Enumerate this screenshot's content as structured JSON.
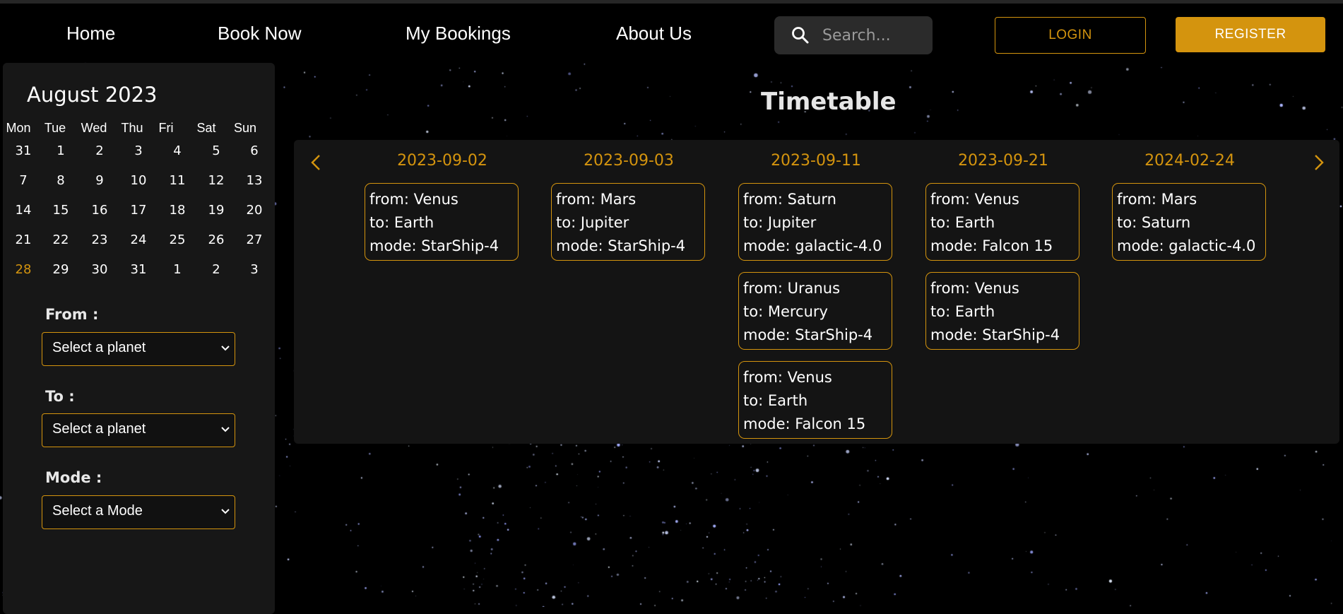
{
  "nav": {
    "links": [
      "Home",
      "Book Now",
      "My Bookings",
      "About Us"
    ],
    "search_placeholder": "Search...",
    "login_label": "LOGIN",
    "register_label": "REGISTER"
  },
  "calendar": {
    "month_title": "August 2023",
    "weekdays": [
      "Mon",
      "Tue",
      "Wed",
      "Thu",
      "Fri",
      "Sat",
      "Sun"
    ],
    "weeks": [
      [
        "31",
        "1",
        "2",
        "3",
        "4",
        "5",
        "6"
      ],
      [
        "7",
        "8",
        "9",
        "10",
        "11",
        "12",
        "13"
      ],
      [
        "14",
        "15",
        "16",
        "17",
        "18",
        "19",
        "20"
      ],
      [
        "21",
        "22",
        "23",
        "24",
        "25",
        "26",
        "27"
      ],
      [
        "28",
        "29",
        "30",
        "31",
        "1",
        "2",
        "3"
      ]
    ],
    "highlighted_day": "28"
  },
  "filters": {
    "from_label": "From :",
    "from_value": "Select a planet",
    "to_label": "To :",
    "to_value": "Select a planet",
    "mode_label": "Mode :",
    "mode_value": "Select a Mode"
  },
  "timetable": {
    "title": "Timetable",
    "columns": [
      {
        "date": "2023-09-02",
        "trips": [
          {
            "from": "from: Venus",
            "to": "to: Earth",
            "mode": "mode: StarShip-4"
          }
        ]
      },
      {
        "date": "2023-09-03",
        "trips": [
          {
            "from": "from: Mars",
            "to": "to: Jupiter",
            "mode": "mode: StarShip-4"
          }
        ]
      },
      {
        "date": "2023-09-11",
        "trips": [
          {
            "from": "from: Saturn",
            "to": "to: Jupiter",
            "mode": "mode: galactic-4.0"
          },
          {
            "from": "from: Uranus",
            "to": "to: Mercury",
            "mode": "mode: StarShip-4"
          },
          {
            "from": "from: Venus",
            "to": "to: Earth",
            "mode": "mode: Falcon 15"
          }
        ]
      },
      {
        "date": "2023-09-21",
        "trips": [
          {
            "from": "from: Venus",
            "to": "to: Earth",
            "mode": "mode: Falcon 15"
          },
          {
            "from": "from: Venus",
            "to": "to: Earth",
            "mode": "mode: StarShip-4"
          }
        ]
      },
      {
        "date": "2024-02-24",
        "trips": [
          {
            "from": "from: Mars",
            "to": "to: Saturn",
            "mode": "mode: galactic-4.0"
          }
        ]
      }
    ]
  },
  "colors": {
    "accent": "#d4940e",
    "background": "#000000",
    "panel": "#171717"
  }
}
